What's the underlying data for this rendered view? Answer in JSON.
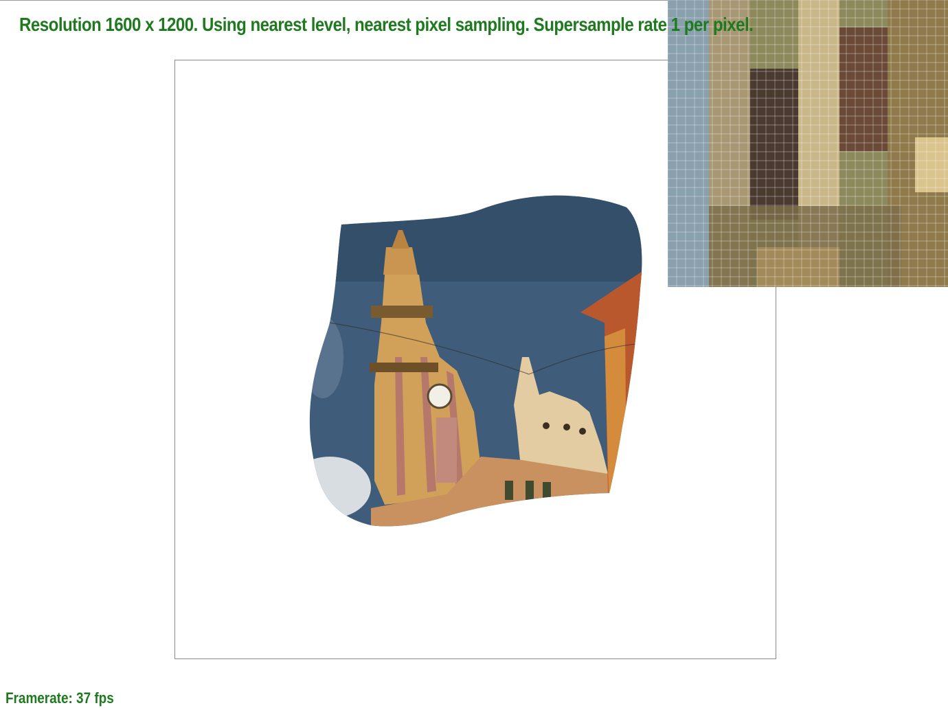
{
  "status_text": "Resolution 1600 x 1200. Using nearest level, nearest pixel sampling. Supersample rate 1 per pixel.",
  "framerate_text": "Framerate: 37 fps",
  "colors": {
    "text": "#1f7a1f",
    "frame_border": "#8a8a8a",
    "sky": "#3b5876",
    "tower": "#d3a25a",
    "tower_stripe": "#b4776a",
    "building": "#c8825a",
    "brick": "#b5562d"
  },
  "icons": {
    "texture": "church-tower-image",
    "zoom": "pixel-magnifier"
  }
}
